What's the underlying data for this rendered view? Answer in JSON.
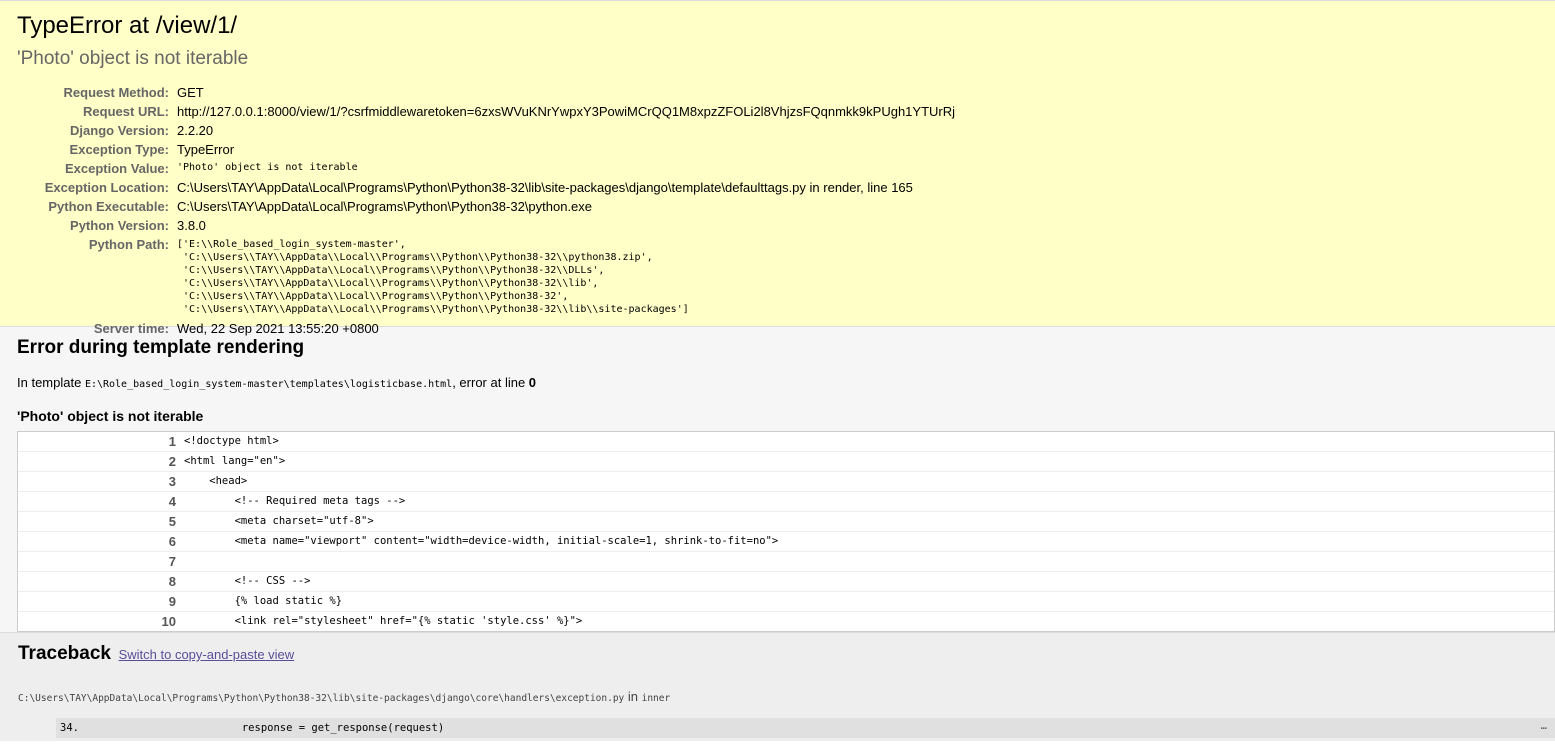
{
  "summary": {
    "title": "TypeError at /view/1/",
    "subtitle": "'Photo' object is not iterable",
    "meta": [
      {
        "label": "Request Method:",
        "value": "GET"
      },
      {
        "label": "Request URL:",
        "value": "http://127.0.0.1:8000/view/1/?csrfmiddlewaretoken=6zxsWVuKNrYwpxY3PowiMCrQQ1M8xpzZFOLi2l8VhjzsFQqnmkk9kPUgh1YTUrRj"
      },
      {
        "label": "Django Version:",
        "value": "2.2.20"
      },
      {
        "label": "Exception Type:",
        "value": "TypeError"
      },
      {
        "label": "Exception Value:",
        "value": "'Photo' object is not iterable"
      },
      {
        "label": "Exception Location:",
        "value": "C:\\Users\\TAY\\AppData\\Local\\Programs\\Python\\Python38-32\\lib\\site-packages\\django\\template\\defaulttags.py in render, line 165"
      },
      {
        "label": "Python Executable:",
        "value": "C:\\Users\\TAY\\AppData\\Local\\Programs\\Python\\Python38-32\\python.exe"
      },
      {
        "label": "Python Version:",
        "value": "3.8.0"
      },
      {
        "label": "Python Path:",
        "value": "['E:\\\\Role_based_login_system-master',\n 'C:\\\\Users\\\\TAY\\\\AppData\\\\Local\\\\Programs\\\\Python\\\\Python38-32\\\\python38.zip',\n 'C:\\\\Users\\\\TAY\\\\AppData\\\\Local\\\\Programs\\\\Python\\\\Python38-32\\\\DLLs',\n 'C:\\\\Users\\\\TAY\\\\AppData\\\\Local\\\\Programs\\\\Python\\\\Python38-32\\\\lib',\n 'C:\\\\Users\\\\TAY\\\\AppData\\\\Local\\\\Programs\\\\Python\\\\Python38-32',\n 'C:\\\\Users\\\\TAY\\\\AppData\\\\Local\\\\Programs\\\\Python\\\\Python38-32\\\\lib\\\\site-packages']"
      },
      {
        "label": "Server time:",
        "value": "Wed, 22 Sep 2021 13:55:20 +0800"
      }
    ]
  },
  "template": {
    "heading": "Error during template rendering",
    "intro_prefix": "In template ",
    "template_path": "E:\\Role_based_login_system-master\\templates\\logisticbase.html",
    "intro_middle": ", error at line ",
    "error_line": "0",
    "error_message": "'Photo' object is not iterable",
    "lines": [
      {
        "num": "1",
        "code": "<!doctype html>"
      },
      {
        "num": "2",
        "code": "<html lang=\"en\">"
      },
      {
        "num": "3",
        "code": "    <head>"
      },
      {
        "num": "4",
        "code": "        <!-- Required meta tags -->"
      },
      {
        "num": "5",
        "code": "        <meta charset=\"utf-8\">"
      },
      {
        "num": "6",
        "code": "        <meta name=\"viewport\" content=\"width=device-width, initial-scale=1, shrink-to-fit=no\">"
      },
      {
        "num": "7",
        "code": ""
      },
      {
        "num": "8",
        "code": "        <!-- CSS -->"
      },
      {
        "num": "9",
        "code": "        {% load static %}"
      },
      {
        "num": "10",
        "code": "        <link rel=\"stylesheet\" href=\"{% static 'style.css' %}\">"
      }
    ]
  },
  "traceback": {
    "heading": "Traceback",
    "switch_link": "Switch to copy-and-paste view",
    "frame_path": "C:\\Users\\TAY\\AppData\\Local\\Programs\\Python\\Python38-32\\lib\\site-packages\\django\\core\\handlers\\exception.py",
    "frame_in": " in ",
    "frame_func": "inner",
    "frame_line_num": "34.",
    "frame_code": "            response = get_response(request)",
    "frame_more": "…"
  }
}
